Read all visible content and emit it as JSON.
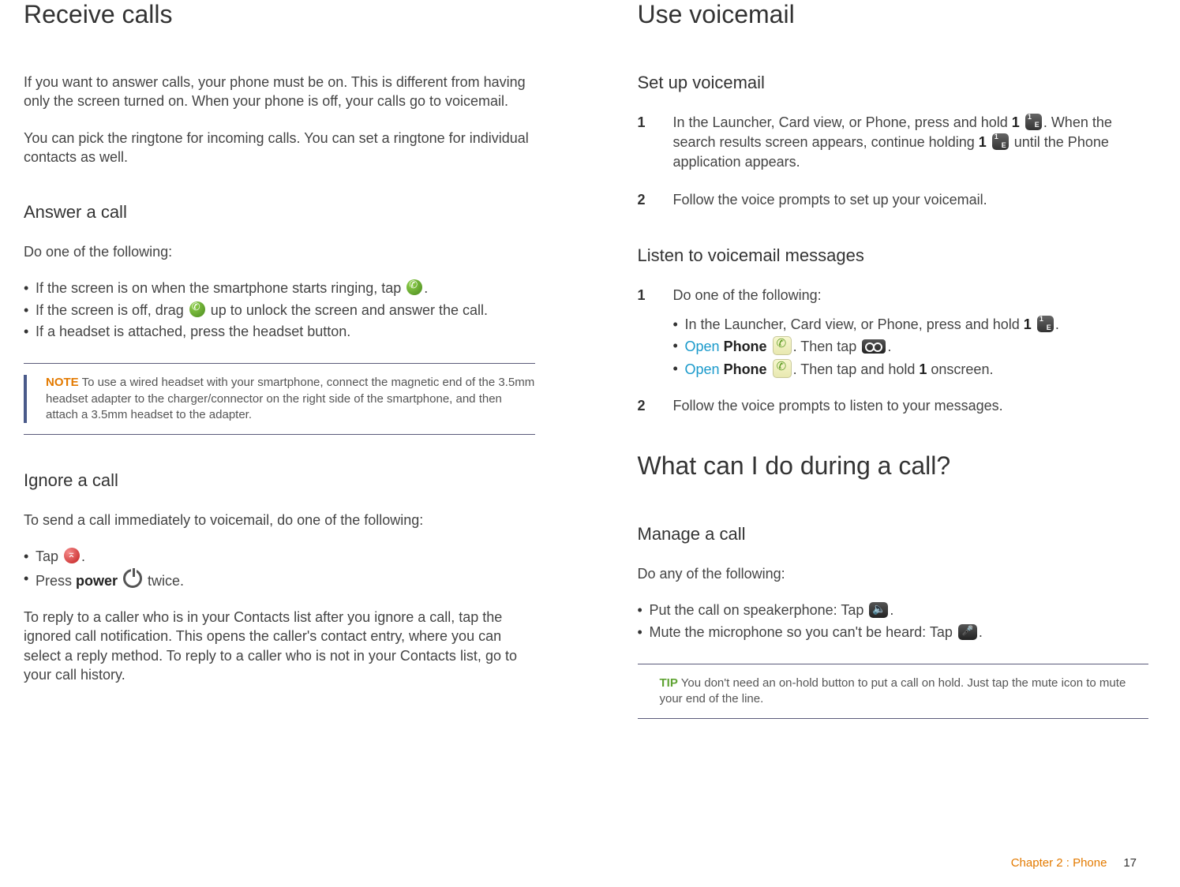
{
  "left": {
    "h1": "Receive calls",
    "intro1": "If you want to answer calls, your phone must be on. This is different from having only the screen turned on. When your phone is off, your calls go to voicemail.",
    "intro2": "You can pick the ringtone for incoming calls. You can set a ringtone for individual contacts as well.",
    "answer_h": "Answer a call",
    "answer_lead": "Do one of the following:",
    "answer_b1a": "If the screen is on when the smartphone starts ringing, tap ",
    "answer_b1b": ".",
    "answer_b2a": "If the screen is off, drag ",
    "answer_b2b": " up to unlock the screen and answer the call.",
    "answer_b3": "If a headset is attached, press the headset button.",
    "note_label": "NOTE",
    "note_text": "  To use a wired headset with your smartphone, connect the magnetic end of the 3.5mm headset adapter to the charger/connector on the right side of the smartphone, and then attach a 3.5mm headset to the adapter.",
    "ignore_h": "Ignore a call",
    "ignore_lead": "To send a call immediately to voicemail, do one of the following:",
    "ignore_b1a": "Tap ",
    "ignore_b1b": ".",
    "ignore_b2a": "Press ",
    "ignore_b2_power": "power",
    "ignore_b2b": " twice.",
    "ignore_para": "To reply to a caller who is in your Contacts list after you ignore a call, tap the ignored call notification. This opens the caller's contact entry, where you can select a reply method. To reply to a caller who is not in your Contacts list, go to your call history."
  },
  "right": {
    "h1a": "Use voicemail",
    "setup_h": "Set up voicemail",
    "setup_s1a": "In the Launcher, Card view, or Phone, press and hold ",
    "setup_s1_1": "1",
    "setup_s1b": ". When the search results screen appears, continue holding ",
    "setup_s1c": " until the Phone application appears.",
    "setup_s2": "Follow the voice prompts to set up your voicemail.",
    "listen_h": "Listen to voicemail messages",
    "listen_s1": "Do one of the following:",
    "listen_b1a": "In the Launcher, Card view, or Phone, press and hold ",
    "listen_b1_1": "1",
    "listen_b1b": ".",
    "listen_b2_open": "Open",
    "listen_b2_phone": "Phone",
    "listen_b2b": ". Then tap ",
    "listen_b2c": ".",
    "listen_b3_open": "Open",
    "listen_b3_phone": "Phone",
    "listen_b3b": ". Then tap and hold ",
    "listen_b3_1": "1",
    "listen_b3c": " onscreen.",
    "listen_s2": "Follow the voice prompts to listen to your messages.",
    "h1b": "What can I do during a call?",
    "manage_h": "Manage a call",
    "manage_lead": "Do any of the following:",
    "manage_b1a": "Put the call on speakerphone: Tap ",
    "manage_b1b": ".",
    "manage_b2a": "Mute the microphone so you can't be heard: Tap ",
    "manage_b2b": ".",
    "tip_label": "TIP",
    "tip_text": "  You don't need an on-hold button to put a call on hold. Just tap the mute icon to mute your end of the line."
  },
  "footer": {
    "chapter": "Chapter 2  :  Phone",
    "page": "17"
  }
}
